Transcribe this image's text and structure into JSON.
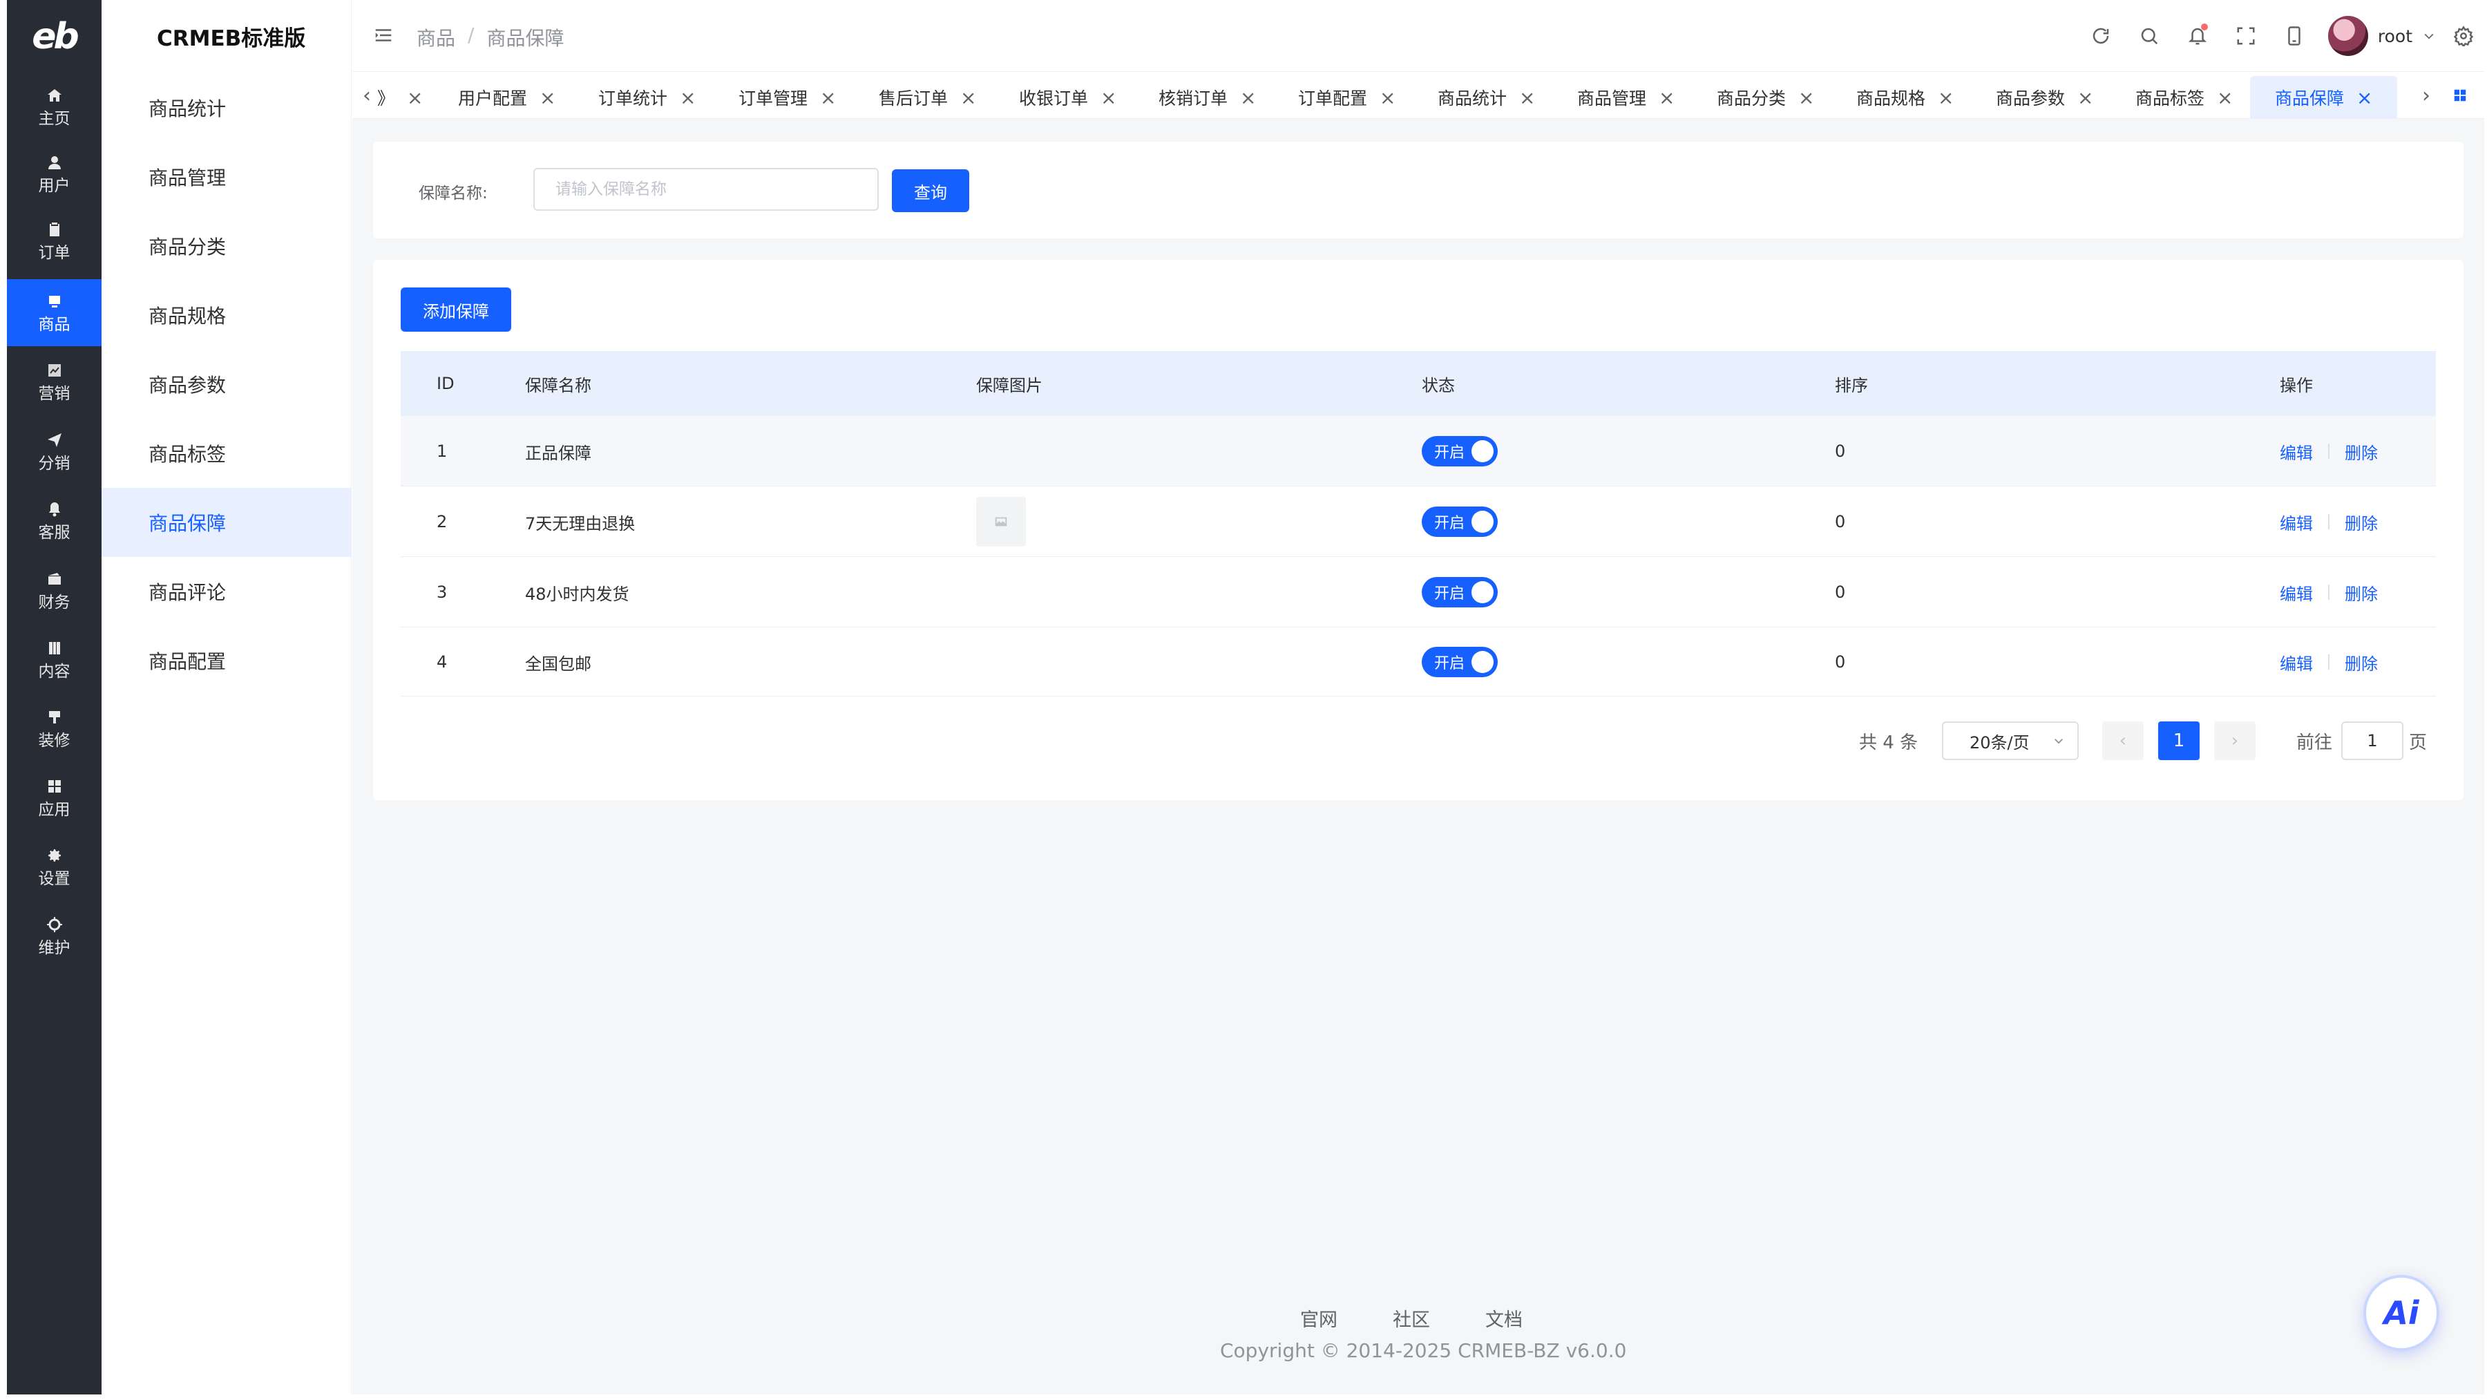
{
  "app": {
    "logo_text": "eb",
    "brand": "CRMEB标准版"
  },
  "rail": [
    {
      "label": "主页",
      "icon": "home-icon"
    },
    {
      "label": "用户",
      "icon": "user-icon"
    },
    {
      "label": "订单",
      "icon": "clipboard-icon"
    },
    {
      "label": "商品",
      "icon": "product-icon",
      "active": true
    },
    {
      "label": "营销",
      "icon": "chart-icon"
    },
    {
      "label": "分销",
      "icon": "send-icon"
    },
    {
      "label": "客服",
      "icon": "bell-icon"
    },
    {
      "label": "财务",
      "icon": "wallet-icon"
    },
    {
      "label": "内容",
      "icon": "book-icon"
    },
    {
      "label": "装修",
      "icon": "brush-icon"
    },
    {
      "label": "应用",
      "icon": "apps-icon"
    },
    {
      "label": "设置",
      "icon": "gear-icon"
    },
    {
      "label": "维护",
      "icon": "maintenance-icon"
    }
  ],
  "subnav": [
    {
      "label": "商品统计"
    },
    {
      "label": "商品管理"
    },
    {
      "label": "商品分类"
    },
    {
      "label": "商品规格"
    },
    {
      "label": "商品参数"
    },
    {
      "label": "商品标签"
    },
    {
      "label": "商品保障",
      "active": true
    },
    {
      "label": "商品评论"
    },
    {
      "label": "商品配置"
    }
  ],
  "breadcrumb": {
    "first": "商品",
    "separator": "/",
    "current": "商品保障"
  },
  "user": {
    "name": "root"
  },
  "tabs": [
    {
      "label": "用户配置"
    },
    {
      "label": "订单统计"
    },
    {
      "label": "订单管理"
    },
    {
      "label": "售后订单"
    },
    {
      "label": "收银订单"
    },
    {
      "label": "核销订单"
    },
    {
      "label": "订单配置"
    },
    {
      "label": "商品统计"
    },
    {
      "label": "商品管理"
    },
    {
      "label": "商品分类"
    },
    {
      "label": "商品规格"
    },
    {
      "label": "商品参数"
    },
    {
      "label": "商品标签"
    },
    {
      "label": "商品保障",
      "active": true
    }
  ],
  "tab_partial": "》",
  "search": {
    "label": "保障名称:",
    "placeholder": "请输入保障名称",
    "value": "",
    "button": "查询"
  },
  "add_button": "添加保障",
  "table": {
    "columns": [
      "ID",
      "保障名称",
      "保障图片",
      "状态",
      "排序",
      "操作"
    ],
    "rows": [
      {
        "id": "1",
        "name": "正品保障",
        "has_image": false,
        "status": "开启",
        "sort": "0",
        "edit": "编辑",
        "delete": "删除"
      },
      {
        "id": "2",
        "name": "7天无理由退换",
        "has_image": true,
        "status": "开启",
        "sort": "0",
        "edit": "编辑",
        "delete": "删除"
      },
      {
        "id": "3",
        "name": "48小时内发货",
        "has_image": false,
        "status": "开启",
        "sort": "0",
        "edit": "编辑",
        "delete": "删除"
      },
      {
        "id": "4",
        "name": "全国包邮",
        "has_image": false,
        "status": "开启",
        "sort": "0",
        "edit": "编辑",
        "delete": "删除"
      }
    ]
  },
  "pagination": {
    "total": "共 4 条",
    "page_size": "20条/页",
    "current_page": "1",
    "goto_label": "前往",
    "goto_value": "1",
    "page_suffix": "页"
  },
  "footer": {
    "links": [
      "官网",
      "社区",
      "文档"
    ],
    "copyright": "Copyright © 2014-2025 CRMEB-BZ v6.0.0"
  },
  "ai_button": "Ai",
  "colors": {
    "accent": "#1660ff",
    "rail_bg": "#282c34",
    "header_row": "#e8f0fe"
  }
}
